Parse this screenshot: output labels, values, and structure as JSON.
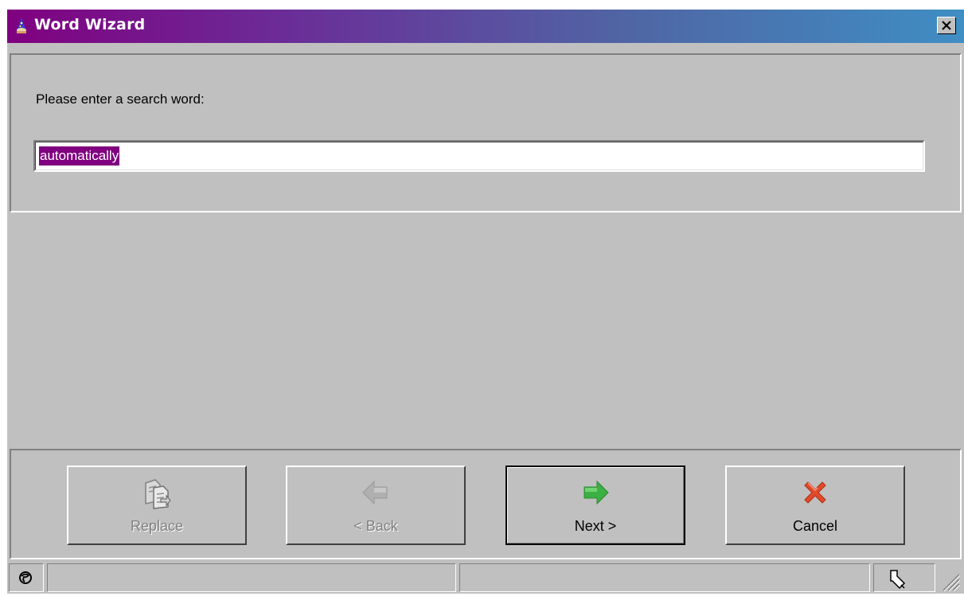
{
  "window": {
    "title": "Word Wizard"
  },
  "form": {
    "prompt": "Please enter a search word:",
    "search_value": "automatically"
  },
  "buttons": {
    "replace": {
      "label": "Replace",
      "enabled": false
    },
    "back": {
      "label": "< Back",
      "enabled": false
    },
    "next": {
      "label": "Next >",
      "enabled": true,
      "default": true
    },
    "cancel": {
      "label": "Cancel",
      "enabled": true
    }
  },
  "icons": {
    "app": "wizard-icon",
    "close": "close-icon",
    "replace": "replace-document-icon",
    "back": "arrow-left-icon",
    "next": "arrow-right-icon",
    "cancel": "x-icon",
    "status_left": "globe-icon",
    "status_right": "pointer-cursor-icon",
    "grip": "resize-grip-icon"
  },
  "colors": {
    "title_gradient_start": "#800080",
    "title_gradient_end": "#3f8ec4",
    "selection": "#800080",
    "next_arrow": "#3cb043",
    "cancel_x": "#e04a2a"
  }
}
